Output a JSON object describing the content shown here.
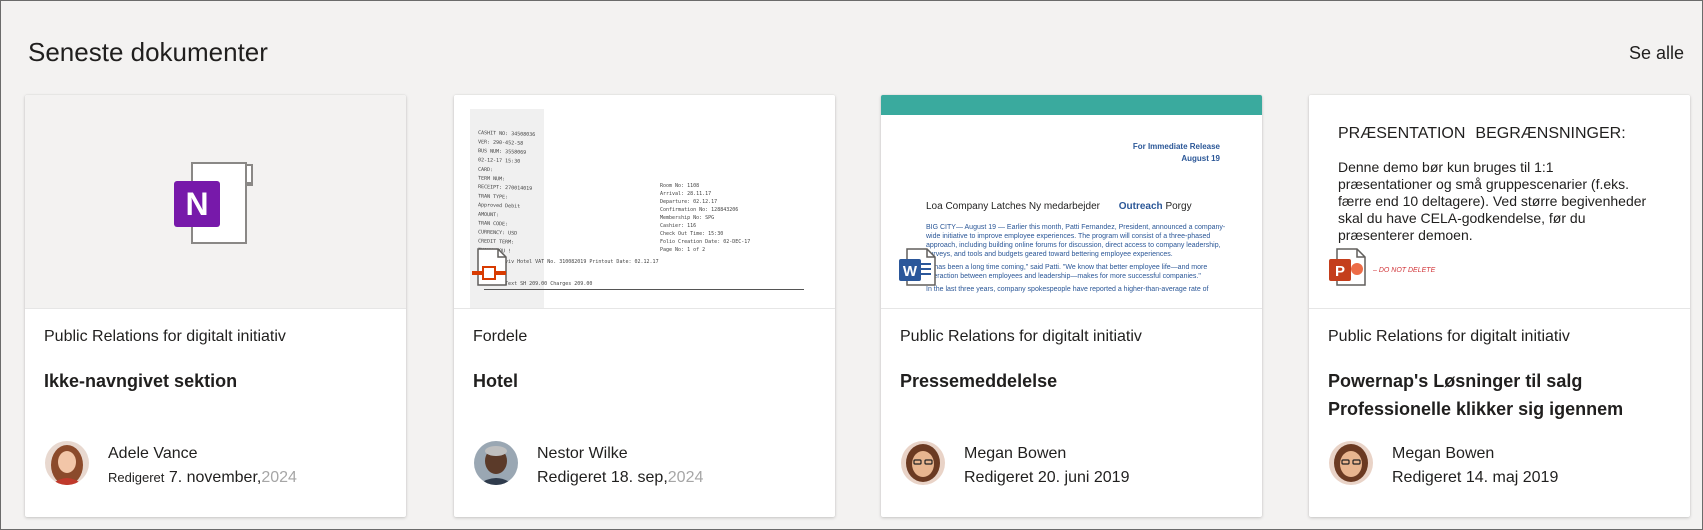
{
  "header": {
    "title": "Seneste dokumenter",
    "see_all": "Se alle"
  },
  "cards": [
    {
      "type": "onenote",
      "location": "Public Relations for digitalt initiativ",
      "title_lines": [
        "Ikke-navngivet sektion"
      ],
      "author": "Adele Vance",
      "edited_label": "Redigeret",
      "edited_date": "7. november,",
      "edited_year": "2024",
      "thumb": {}
    },
    {
      "type": "receipt",
      "location": "Fordele",
      "title_lines": [
        "Hotel"
      ],
      "author": "Nestor Wilke",
      "edited_label": "Redigeret",
      "edited_date": "18. sep,",
      "edited_year": "2024",
      "thumb": {
        "lines": [
          "CASHIT NO: 34508036",
          "VER: 290-452-58",
          "BUS NUM: 3558069",
          "02-12-17 15:30",
          "CARD:",
          "TERM NUM:",
          "RECEIPT: 270014019",
          "TRAN TYPE:",
          "Approved Debit",
          "AMOUNT:",
          "TRAN CODE:",
          "CURRENCY: USD",
          "CREDIT TERM:",
          "THANK YOU !"
        ],
        "right_lines": [
          "Room No: 1108",
          "Arrival: 28.11.17",
          "Departure: 02.12.17",
          "Confirmation No: 128843206",
          "Membership No: SPG",
          "Cashier: 116",
          "Check Out Time: 15:30",
          "Folio Creation Date: 02-DEC-17",
          "Page No: 1 of 2"
        ],
        "bottom_lines": [
          "Tel Aviv Hotel   VAT No. 310082019   Printout Date: 02.12.17",
          "Date   Text   SH 209.00   Charges   209.00"
        ]
      }
    },
    {
      "type": "word",
      "location": "Public Relations for digitalt initiativ",
      "title_lines": [
        "Pressemeddelelse"
      ],
      "author": "Megan Bowen",
      "edited_label": "Redigeret",
      "edited_date": "20. juni 2019",
      "edited_year": "",
      "thumb": {
        "release_line1": "For Immediate Release",
        "release_line2": "August 19",
        "headline": "Loa Company Latches Ny medarbejder",
        "outreach": "Outreach",
        "headline_end": "Porgy",
        "paragraphs": [
          "BIG CITY— August 19 — Earlier this month, Patti Fernandez, President, announced a company-",
          "wide initiative to improve employee experiences. The program will consist of a three-phased",
          "approach, including building online forums for discussion, direct access to company leadership,",
          "surveys, and tools and budgets geared toward bettering employee experiences.",
          "\"It has been a long time coming,\" said Patti. \"We know that better employee life—and more",
          "interaction between employees and leadership—makes for more successful companies.\"",
          "In the last three years, company spokespeople have reported a higher-than-average rate of"
        ]
      }
    },
    {
      "type": "powerpoint",
      "location": "Public Relations for digitalt initiativ",
      "title_lines": [
        "Powernap's Løsninger til salg",
        "Professionelle klikker sig igennem"
      ],
      "author": "Megan Bowen",
      "edited_label": "Redigeret",
      "edited_date": "14. maj 2019",
      "edited_year": "",
      "thumb": {
        "heading1": "PRÆSENTATION",
        "heading2": "BEGRÆNSNINGER:",
        "body": "Denne demo bør kun bruges til 1:1 præsentationer og små gruppescenarier (f.eks. færre end 10 deltagere). Ved større begivenheder skal du have CELA-godkendelse, før du præsenterer demoen.",
        "dnd": "– DO NOT DELETE"
      }
    }
  ],
  "colors": {
    "background": "#f3f2f1",
    "onenote": "#7719aa",
    "word": "#2b579a",
    "powerpoint": "#c43e1c",
    "teal": "#3aaa9e"
  },
  "icons": {
    "onenote": "onenote-file-icon",
    "word": "word-file-icon",
    "powerpoint": "powerpoint-file-icon",
    "receipt": "document-file-icon"
  }
}
